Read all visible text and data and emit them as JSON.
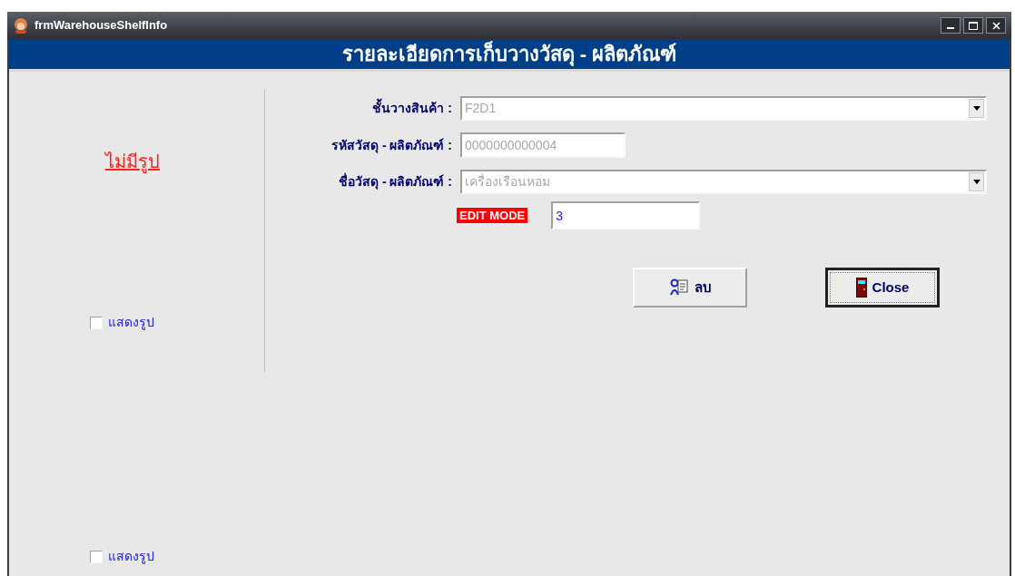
{
  "window": {
    "title": "frmWarehouseShelfInfo"
  },
  "header": {
    "title": "รายละเอียดการเก็บวางวัสดุ - ผลิตภัณฑ์"
  },
  "image_panel": {
    "no_image_text": "ไม่มีรูป",
    "checkboxes": [
      {
        "label": "แสดงรูป",
        "checked": false
      },
      {
        "label": "แสดงรูป",
        "checked": false
      }
    ]
  },
  "form": {
    "fields": [
      {
        "kind": "combo",
        "label": "ชั้นวางสินค้า :",
        "value": "F2D1",
        "disabled": true
      },
      {
        "kind": "text",
        "label": "รหัสวัสดุ - ผลิตภัณฑ์ :",
        "value": "0000000000004",
        "disabled": true
      },
      {
        "kind": "combo",
        "label": "ชื่อวัสดุ - ผลิตภัณฑ์ :",
        "value": "เครื่องเรือนหอม",
        "disabled": true
      }
    ],
    "mode_badge": "EDIT MODE",
    "mode_value": "3",
    "buttons": [
      {
        "kind": "delete",
        "label": "ลบ",
        "focused": false
      },
      {
        "kind": "close",
        "label": "Close",
        "focused": true
      }
    ]
  }
}
